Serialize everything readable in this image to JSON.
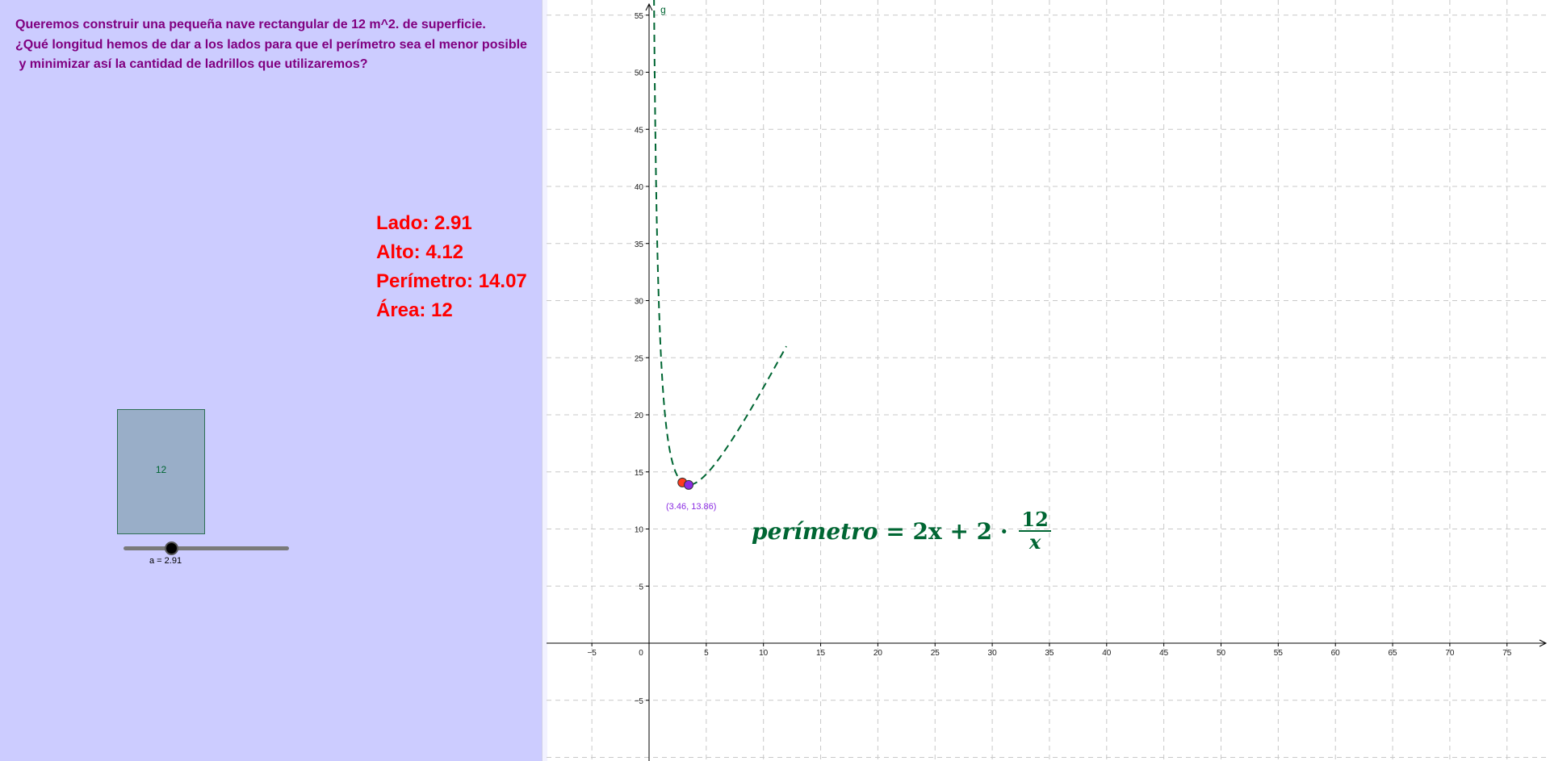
{
  "problem": {
    "lines": [
      "Queremos construir una pequeña nave rectangular de 12 m^2. de superficie.",
      "¿Qué longitud hemos de dar a los lados para que el perímetro sea el menor posible",
      " y minimizar así la cantidad de ladrillos que utilizaremos?"
    ]
  },
  "stats": {
    "lado": "Lado: 2.91",
    "alto": "Alto: 4.12",
    "perimetro": "Perímetro: 14.07",
    "area": "Área: 12"
  },
  "rectangle": {
    "label": "12"
  },
  "slider": {
    "caption": "a = 2.91",
    "value": 2.91,
    "min": 0,
    "max": 10
  },
  "formula": {
    "lhs": "perímetro",
    "rhs": " = 2x + 2 · ",
    "numerator": "12",
    "denominator": "x"
  },
  "graph": {
    "curve_label": "g",
    "min_point_label": "(3.46, 13.86)",
    "x_ticks": [
      "-5",
      "0",
      "5",
      "10",
      "15",
      "20",
      "25",
      "30",
      "35",
      "40",
      "45",
      "50",
      "55",
      "60",
      "65",
      "70",
      "75"
    ],
    "y_ticks": [
      "55",
      "50",
      "45",
      "40",
      "35",
      "30",
      "25",
      "20",
      "15",
      "10",
      "5",
      "-5"
    ],
    "curve_color": "#006633",
    "point_current_color": "#ff3b1f",
    "point_min_color": "#8a2be2",
    "min_point_label_color": "#8a2be2",
    "curve_x_range": [
      0.218,
      12
    ],
    "current_point": [
      2.91,
      14.07
    ],
    "min_point": [
      3.46,
      13.86
    ]
  }
}
